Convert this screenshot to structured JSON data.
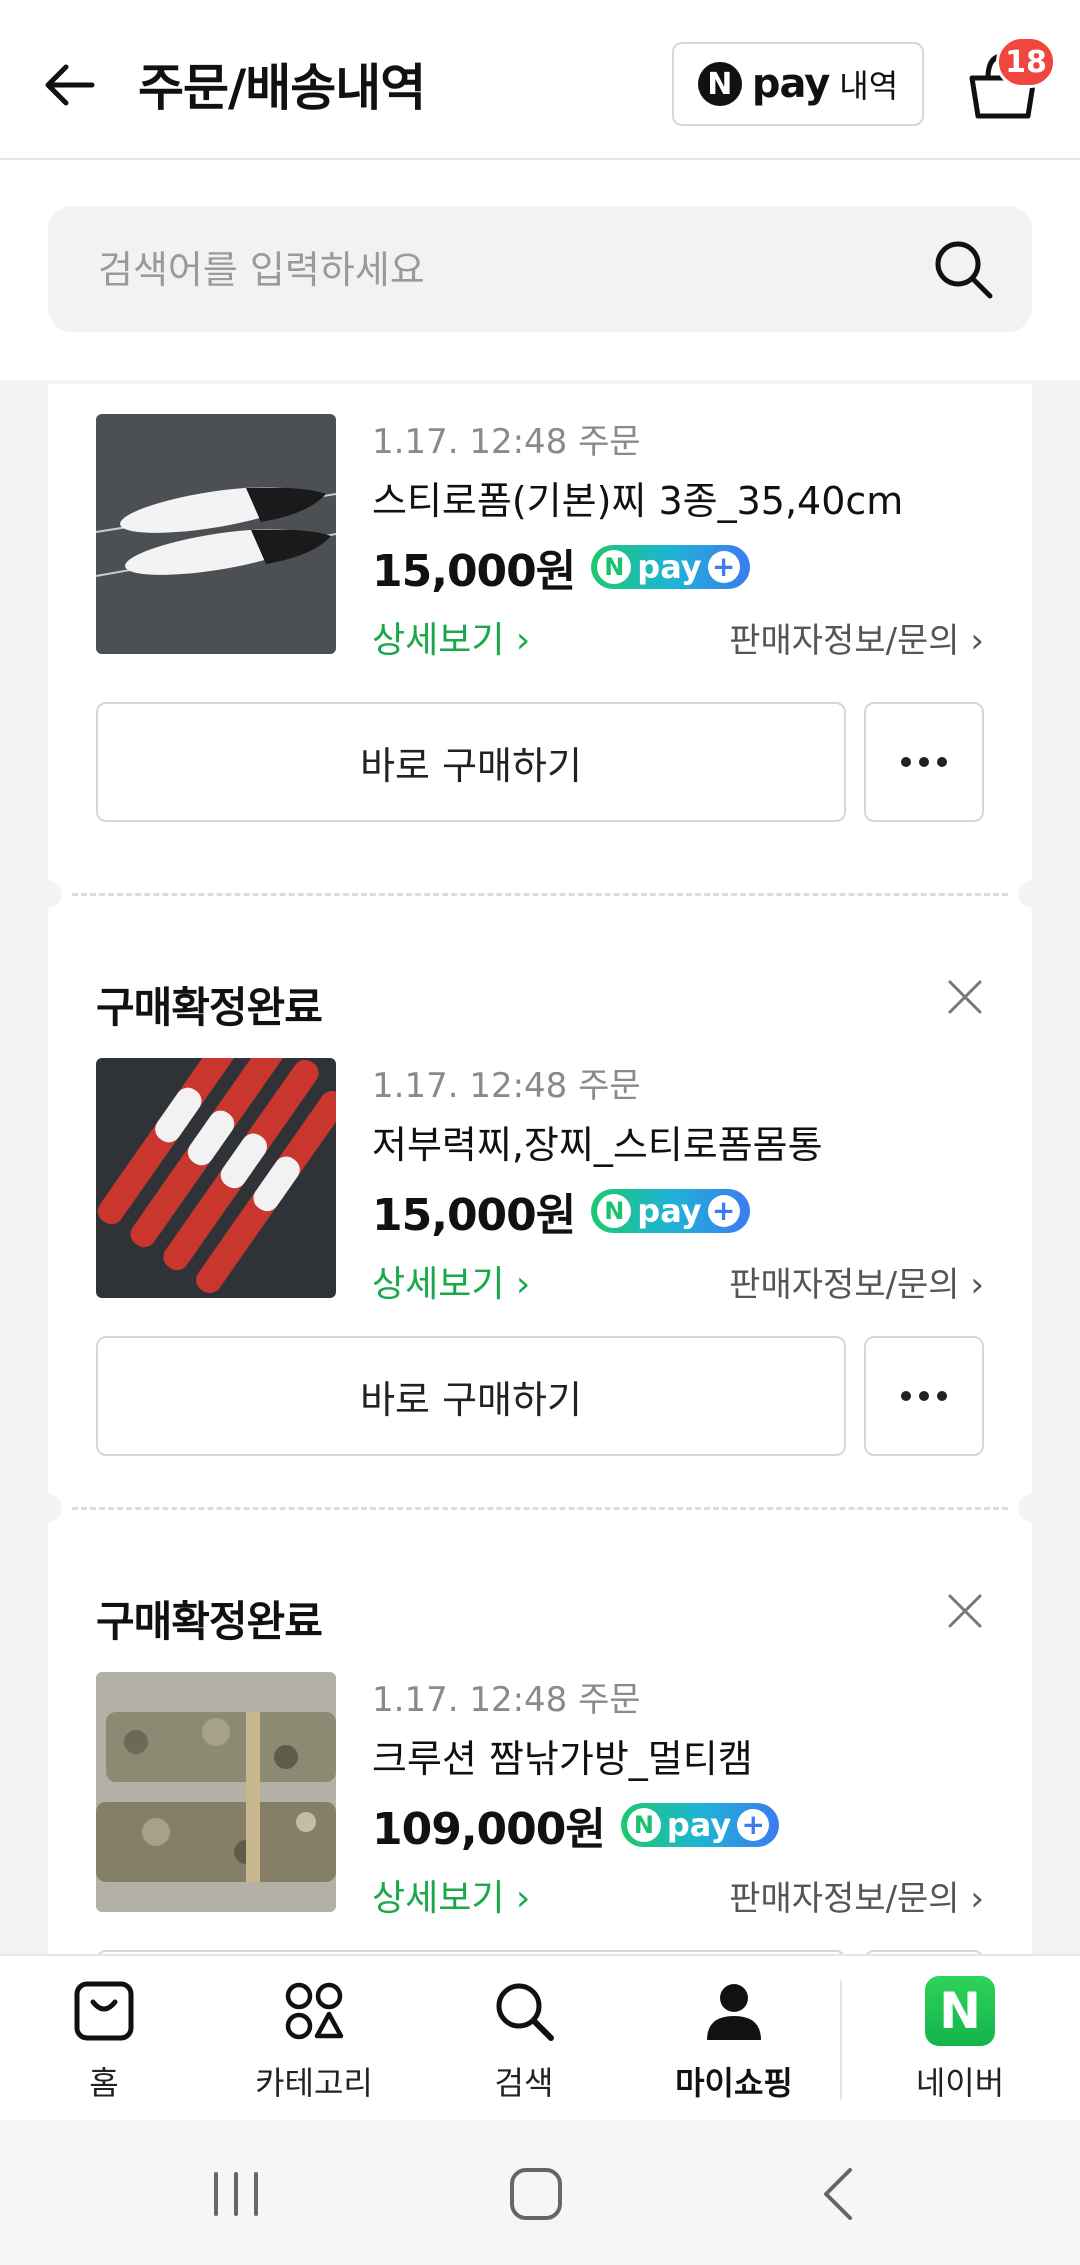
{
  "header": {
    "title": "주문/배송내역",
    "npay_mark": "N",
    "npay_word": "pay",
    "npay_sub": "내역",
    "cart_count": "18"
  },
  "search": {
    "placeholder": "검색어를 입력하세요"
  },
  "orders": [
    {
      "status": "",
      "date": "1.17. 12:48 주문",
      "name": "스티로폼(기본)찌 3종_35,40cm",
      "price": "15,000원",
      "detail_label": "상세보기 ›",
      "seller_label": "판매자정보/문의 ›",
      "buy_label": "바로 구매하기"
    },
    {
      "status": "구매확정완료",
      "date": "1.17. 12:48 주문",
      "name": "저부력찌,장찌_스티로폼몸통",
      "price": "15,000원",
      "detail_label": "상세보기 ›",
      "seller_label": "판매자정보/문의 ›",
      "buy_label": "바로 구매하기"
    },
    {
      "status": "구매확정완료",
      "date": "1.17. 12:48 주문",
      "name": "크루션 짬낚가방_멀티캠",
      "price": "109,000원",
      "detail_label": "상세보기 ›",
      "seller_label": "판매자정보/문의 ›",
      "buy_label": ""
    }
  ],
  "npay_badge": {
    "mark": "N",
    "word": "pay",
    "plus": "+"
  },
  "nav": [
    {
      "label": "홈",
      "icon": "bag-icon"
    },
    {
      "label": "카테고리",
      "icon": "category-icon"
    },
    {
      "label": "검색",
      "icon": "search-icon"
    },
    {
      "label": "마이쇼핑",
      "icon": "person-icon"
    },
    {
      "label": "네이버",
      "icon": "naver-icon",
      "mark": "N"
    }
  ],
  "colors": {
    "accent_green": "#19a84a",
    "badge_red": "#f0463f"
  }
}
